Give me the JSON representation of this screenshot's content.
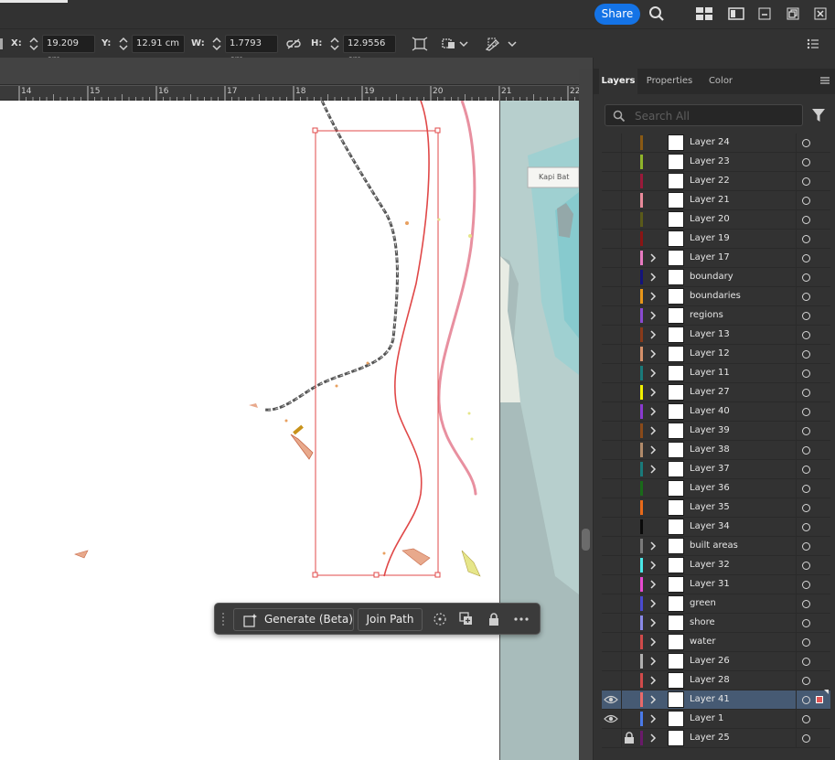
{
  "titlebar": {
    "share_label": "Share",
    "icons": [
      "search-icon",
      "arrange-documents-icon",
      "panel-layout-icon",
      "minimize-icon",
      "restore-icon",
      "close-icon"
    ]
  },
  "controlbar": {
    "x_label": "X:",
    "x_value": "19.209 cm",
    "y_label": "Y:",
    "y_value": "12.91 cm",
    "w_label": "W:",
    "w_value": "1.7793 cm",
    "h_label": "H:",
    "h_value": "12.9556 cm",
    "icons": [
      "link-proportions-icon",
      "transform-each-icon",
      "align-icon",
      "recolor-icon",
      "panel-options-icon"
    ]
  },
  "ruler": {
    "ticks": [
      "14",
      "15",
      "16",
      "17",
      "18",
      "19",
      "20",
      "21",
      "22"
    ]
  },
  "map_strip": {
    "label": "Kapi Bat"
  },
  "taskbar": {
    "generate_label": "Generate (Beta)",
    "join_path_label": "Join Path",
    "icons": [
      "generate-sparkle-icon",
      "anchor-points-icon",
      "duplicate-icon",
      "lock-icon",
      "more-options-icon"
    ]
  },
  "panel": {
    "tabs": [
      {
        "label": "Layers",
        "active": true
      },
      {
        "label": "Properties",
        "active": false
      },
      {
        "label": "Color",
        "active": false
      }
    ],
    "search_placeholder": "Search All",
    "layers": [
      {
        "name": "Layer 24",
        "color": "#8a5a14",
        "expand": false,
        "visible": false,
        "locked": false,
        "selected": false
      },
      {
        "name": "Layer 23",
        "color": "#8fb42a",
        "expand": false,
        "visible": false,
        "locked": false,
        "selected": false
      },
      {
        "name": "Layer 22",
        "color": "#9a1a3a",
        "expand": false,
        "visible": false,
        "locked": false,
        "selected": false
      },
      {
        "name": "Layer 21",
        "color": "#e88a9a",
        "expand": false,
        "visible": false,
        "locked": false,
        "selected": false
      },
      {
        "name": "Layer 20",
        "color": "#5a5a1a",
        "expand": false,
        "visible": false,
        "locked": false,
        "selected": false
      },
      {
        "name": "Layer 19",
        "color": "#8a1414",
        "expand": false,
        "visible": false,
        "locked": false,
        "selected": false
      },
      {
        "name": "Layer 17",
        "color": "#e87ac0",
        "expand": true,
        "visible": false,
        "locked": false,
        "selected": false
      },
      {
        "name": "boundary",
        "color": "#14147a",
        "expand": true,
        "visible": false,
        "locked": false,
        "selected": false
      },
      {
        "name": "boundaries",
        "color": "#e8961a",
        "expand": true,
        "visible": false,
        "locked": false,
        "selected": false
      },
      {
        "name": "regions",
        "color": "#8a4ad0",
        "expand": true,
        "visible": false,
        "locked": false,
        "selected": false
      },
      {
        "name": "Layer 13",
        "color": "#8a3a1a",
        "expand": true,
        "visible": false,
        "locked": false,
        "selected": false
      },
      {
        "name": "Layer 12",
        "color": "#d4906a",
        "expand": true,
        "visible": false,
        "locked": false,
        "selected": false
      },
      {
        "name": "Layer 11",
        "color": "#1a7a7a",
        "expand": true,
        "visible": false,
        "locked": false,
        "selected": false
      },
      {
        "name": "Layer 27",
        "color": "#f0f000",
        "expand": true,
        "visible": false,
        "locked": false,
        "selected": false
      },
      {
        "name": "Layer 40",
        "color": "#8a3ad0",
        "expand": true,
        "visible": false,
        "locked": false,
        "selected": false
      },
      {
        "name": "Layer 39",
        "color": "#8a4a1a",
        "expand": true,
        "visible": false,
        "locked": false,
        "selected": false
      },
      {
        "name": "Layer 38",
        "color": "#b08a6a",
        "expand": true,
        "visible": false,
        "locked": false,
        "selected": false
      },
      {
        "name": "Layer 37",
        "color": "#1a7a7a",
        "expand": true,
        "visible": false,
        "locked": false,
        "selected": false
      },
      {
        "name": "Layer 36",
        "color": "#1a6a1a",
        "expand": false,
        "visible": false,
        "locked": false,
        "selected": false
      },
      {
        "name": "Layer 35",
        "color": "#e86a1a",
        "expand": false,
        "visible": false,
        "locked": false,
        "selected": false
      },
      {
        "name": "Layer 34",
        "color": "#0a0a0a",
        "expand": false,
        "visible": false,
        "locked": false,
        "selected": false
      },
      {
        "name": "built areas",
        "color": "#7a7a7a",
        "expand": true,
        "visible": false,
        "locked": false,
        "selected": false
      },
      {
        "name": "Layer 32",
        "color": "#4ae8e8",
        "expand": true,
        "visible": false,
        "locked": false,
        "selected": false
      },
      {
        "name": "Layer 31",
        "color": "#e84ad0",
        "expand": true,
        "visible": false,
        "locked": false,
        "selected": false
      },
      {
        "name": "green",
        "color": "#4a4ad0",
        "expand": true,
        "visible": false,
        "locked": false,
        "selected": false
      },
      {
        "name": "shore",
        "color": "#8a8ae8",
        "expand": true,
        "visible": false,
        "locked": false,
        "selected": false
      },
      {
        "name": "water",
        "color": "#d04a4a",
        "expand": true,
        "visible": false,
        "locked": false,
        "selected": false
      },
      {
        "name": "Layer 26",
        "color": "#b0b0b0",
        "expand": true,
        "visible": false,
        "locked": false,
        "selected": false
      },
      {
        "name": "Layer 28",
        "color": "#d04a4a",
        "expand": true,
        "visible": false,
        "locked": false,
        "selected": false
      },
      {
        "name": "Layer 41",
        "color": "#e86a6a",
        "expand": true,
        "visible": true,
        "locked": false,
        "selected": true
      },
      {
        "name": "Layer 1",
        "color": "#4a7ae8",
        "expand": true,
        "visible": true,
        "locked": false,
        "selected": false
      },
      {
        "name": "Layer 25",
        "color": "#6a1a6a",
        "expand": true,
        "visible": false,
        "locked": true,
        "selected": false
      }
    ]
  }
}
